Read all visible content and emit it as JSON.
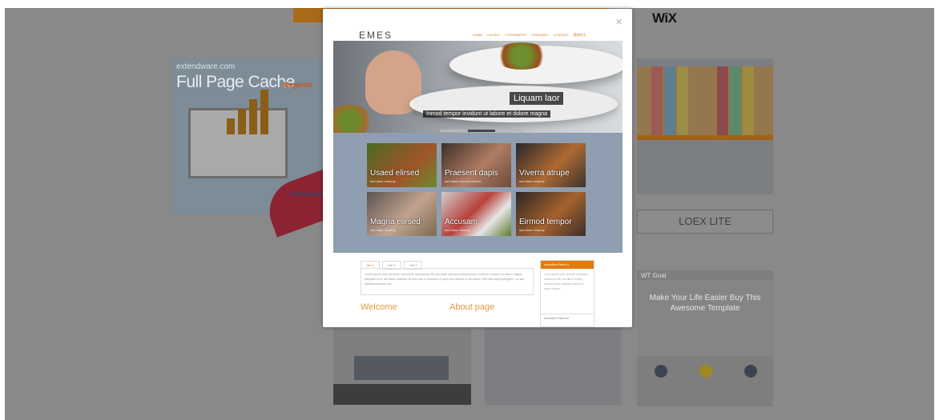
{
  "background": {
    "top_brand": "WiX",
    "cards": {
      "full_page_cache": {
        "small_text": "extendware.com",
        "title": "Full Page Cache",
        "logo_text": "Magento",
        "brand": "extendware"
      },
      "loex": {
        "label": "LOEX LITE"
      },
      "wt_goal": {
        "label": "WT Goal",
        "hero_text": "Make Your Life Easier Buy This Awesome Template"
      }
    }
  },
  "modal": {
    "close_label": "×",
    "preview": {
      "logo": "EMES",
      "nav": [
        "HOME",
        "LAYOUT",
        "TYPOGRAPHY",
        "FEATURES",
        "CONTACT",
        "简体中文"
      ],
      "hero": {
        "title": "Liquam laor",
        "subtitle": "Inmod tempor invidunt ut labore et dolore magna"
      },
      "tiles": [
        {
          "label": "Usaed elirsed",
          "sub": "sed diam nonumy"
        },
        {
          "label": "Praesent dapis",
          "sub": "sed diam nonumy eirmod"
        },
        {
          "label": "Viverra atrupe",
          "sub": "sed diam nonumy"
        },
        {
          "label": "Magna elirsed",
          "sub": "sed diam nonumy"
        },
        {
          "label": "Accusam",
          "sub": "sed diam nonumy"
        },
        {
          "label": "Eirmod tempor",
          "sub": "sed diam nonumy"
        }
      ],
      "tabs": [
        "Tab 1",
        "Tab 2",
        "Tab 3"
      ],
      "tab_text": "Lorem ipsum dolor sit amet, consetetur sadipscing elitr, sed diam nonumy eirmod tempor invidunt ut labore et dolore magna aliquyam erat, sed diam voluptua. At vero eos et accusam et justo duo dolores et ea rebum. Stet clita kasd gubergren, no sea takimata sanctus est.",
      "welcome": "Welcome",
      "about": "About page",
      "accordion": {
        "head1": "Accordion Panel #1",
        "body": "Lorem ipsum dolor sit amet, consetetur sadipscing elitr, sed diam nonumy eirmod tempor invidunt ut labore et dolore magna.",
        "head2": "Accordion Panel #2"
      }
    }
  }
}
